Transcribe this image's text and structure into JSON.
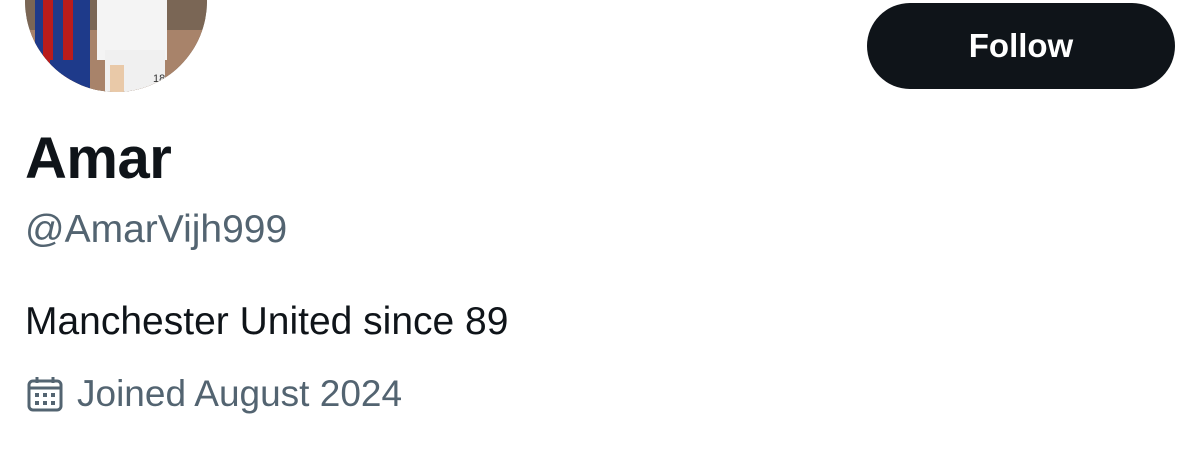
{
  "profile": {
    "display_name": "Amar",
    "handle": "@AmarVijh999",
    "bio": "Manchester United since 89",
    "joined": "Joined August 2024"
  },
  "actions": {
    "follow_label": "Follow"
  },
  "icons": {
    "joined": "calendar-icon"
  },
  "colors": {
    "primary_text": "#0f1419",
    "secondary_text": "#536471",
    "button_bg": "#0f1419",
    "button_text": "#ffffff"
  }
}
